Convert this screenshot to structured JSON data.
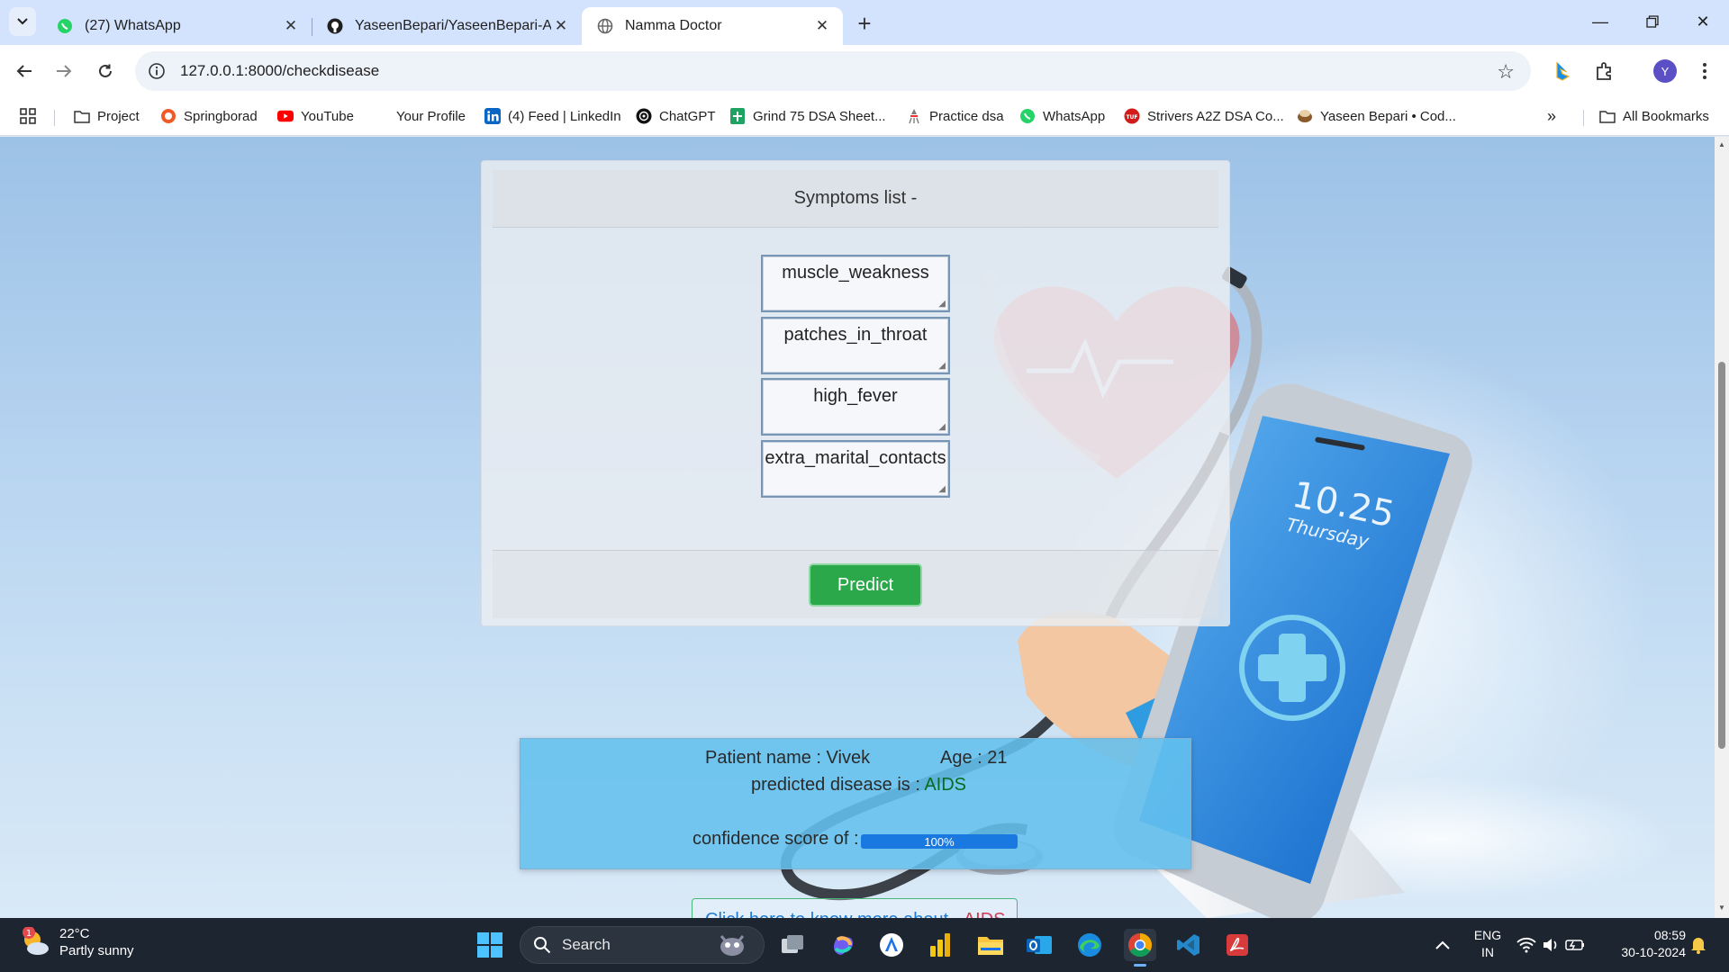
{
  "browser": {
    "tabs": [
      {
        "title": "(27) WhatsApp",
        "icon": "whatsapp-icon"
      },
      {
        "title": "YaseenBepari/YaseenBepari-AI-",
        "icon": "github-icon"
      },
      {
        "title": "Namma Doctor",
        "icon": "globe-icon",
        "active": true
      }
    ],
    "url": "127.0.0.1:8000/checkdisease",
    "profile_initial": "Y",
    "bookmarks": [
      {
        "label": "Project",
        "icon": "folder-icon"
      },
      {
        "label": "Springborad",
        "icon": "springboard-icon"
      },
      {
        "label": "YouTube",
        "icon": "youtube-icon"
      },
      {
        "label": "Your Profile",
        "icon": "none"
      },
      {
        "label": "(4) Feed | LinkedIn",
        "icon": "linkedin-icon"
      },
      {
        "label": "ChatGPT",
        "icon": "chatgpt-icon"
      },
      {
        "label": "Grind 75 DSA Sheet...",
        "icon": "sheet-icon"
      },
      {
        "label": "Practice dsa",
        "icon": "practice-icon"
      },
      {
        "label": "WhatsApp",
        "icon": "whatsapp-icon"
      },
      {
        "label": "Strivers A2Z DSA Co...",
        "icon": "tuf-icon"
      },
      {
        "label": "Yaseen Bepari • Cod...",
        "icon": "codechef-icon"
      }
    ],
    "all_bookmarks": "All Bookmarks"
  },
  "page": {
    "card_title": "Symptoms list -",
    "symptoms": [
      "muscle_weakness",
      "patches_in_throat",
      "high_fever",
      "extra_marital_contacts"
    ],
    "predict_label": "Predict",
    "result": {
      "patient_label": "Patient name : Vivek",
      "age_label": "Age : 21",
      "disease_prefix": "predicted disease is : ",
      "disease": "AIDS",
      "confidence_label": "confidence score of :",
      "confidence": "100%",
      "confidence_value": 100
    },
    "more_link_text": "Click here to know more about - ",
    "more_link_disease": "AIDS",
    "phone_time": "10.25",
    "phone_day": "Thursday"
  },
  "taskbar": {
    "weather_temp": "22°C",
    "weather_desc": "Partly sunny",
    "weather_badge": "1",
    "search_label": "Search",
    "lang_top": "ENG",
    "lang_bottom": "IN",
    "time": "08:59",
    "date": "30-10-2024"
  },
  "colors": {
    "accent_green": "#2aa84a",
    "result_blue": "#63c0ee",
    "progress_blue": "#1a79e0"
  }
}
